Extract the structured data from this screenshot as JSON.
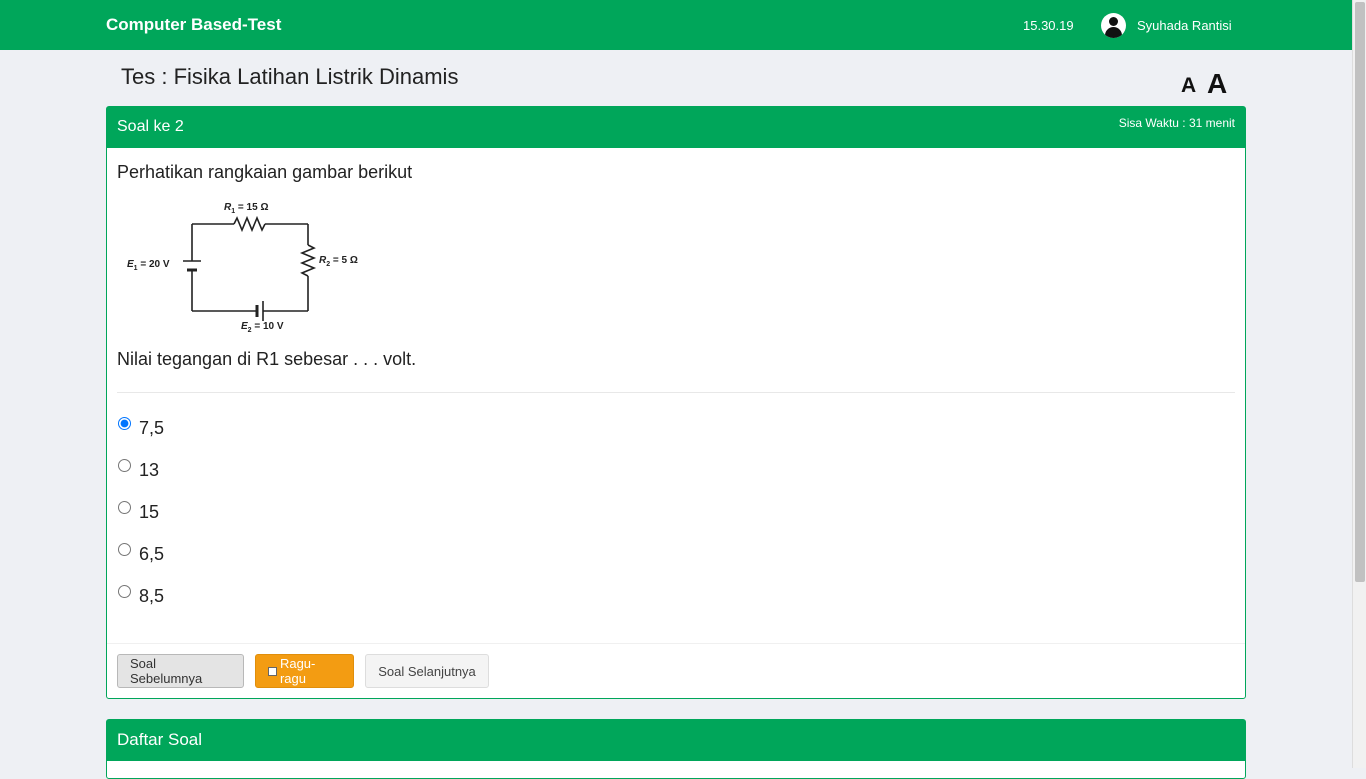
{
  "header": {
    "brand": "Computer Based-Test",
    "time": "15.30.19",
    "user_name": "Syuhada Rantisi",
    "user_icon": "user-circle-icon"
  },
  "test": {
    "title": "Tes : Fisika Latihan Listrik Dinamis",
    "font_small_label": "A",
    "font_large_label": "A"
  },
  "question": {
    "number_label": "Soal ke 2",
    "timer": "Sisa Waktu : 31 menit",
    "text": "Perhatikan rangkaian gambar berikut",
    "ask": "Nilai tegangan di R1 sebesar . . . volt.",
    "circuit": {
      "r1": "R",
      "r1_sub": "1",
      "r1_val": " = 15 Ω",
      "r2": "R",
      "r2_sub": "2",
      "r2_val": " = 5 Ω",
      "e1": "E",
      "e1_sub": "1",
      "e1_val": " = 20 V",
      "e2": "E",
      "e2_sub": "2",
      "e2_val": " = 10 V"
    },
    "options": [
      {
        "label": "7,5",
        "selected": true
      },
      {
        "label": "13",
        "selected": false
      },
      {
        "label": "15",
        "selected": false
      },
      {
        "label": "6,5",
        "selected": false
      },
      {
        "label": "8,5",
        "selected": false
      }
    ]
  },
  "buttons": {
    "prev": "Soal Sebelumnya",
    "doubt": "Ragu-ragu",
    "next": "Soal Selanjutnya"
  },
  "question_list": {
    "title": "Daftar Soal"
  },
  "colors": {
    "primary": "#00a65a",
    "warning": "#f39c12"
  }
}
